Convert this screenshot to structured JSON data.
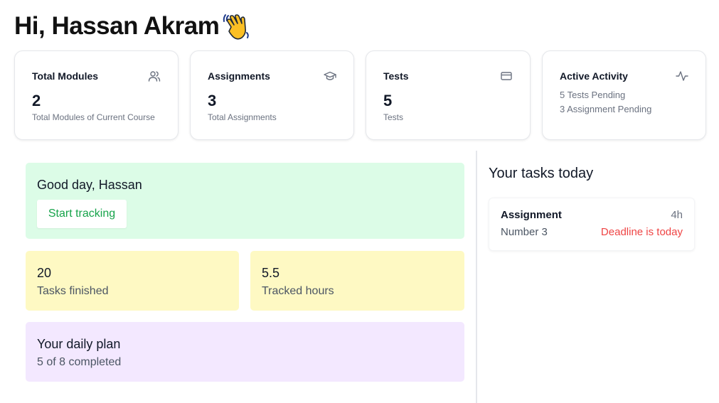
{
  "header": {
    "greeting": "Hi, Hassan Akram",
    "emoji_icon": "waving-hand-icon"
  },
  "stats": [
    {
      "title": "Total Modules",
      "value": "2",
      "subtitle": "Total Modules of Current Course",
      "icon": "users-icon"
    },
    {
      "title": "Assignments",
      "value": "3",
      "subtitle": "Total Assignments",
      "icon": "graduation-cap-icon"
    },
    {
      "title": "Tests",
      "value": "5",
      "subtitle": "Tests",
      "icon": "credit-card-icon"
    },
    {
      "title": "Active Activity",
      "lines": [
        "5 Tests Pending",
        "3 Assignment Pending"
      ],
      "icon": "activity-icon"
    }
  ],
  "welcome": {
    "title": "Good day, Hassan",
    "button_label": "Start tracking"
  },
  "metrics": [
    {
      "value": "20",
      "label": "Tasks finished"
    },
    {
      "value": "5.5",
      "label": "Tracked hours"
    }
  ],
  "plan": {
    "title": "Your daily plan",
    "subtitle": "5 of 8 completed"
  },
  "tasks": {
    "heading": "Your tasks today",
    "items": [
      {
        "title": "Assignment",
        "duration": "4h",
        "subtitle": "Number 3",
        "deadline": "Deadline is today"
      }
    ]
  },
  "colors": {
    "welcome_bg": "#dcfce7",
    "metric_bg": "#fef9c3",
    "plan_bg": "#f3e8ff",
    "accent_green": "#16a34a",
    "deadline_red": "#ef4444"
  }
}
